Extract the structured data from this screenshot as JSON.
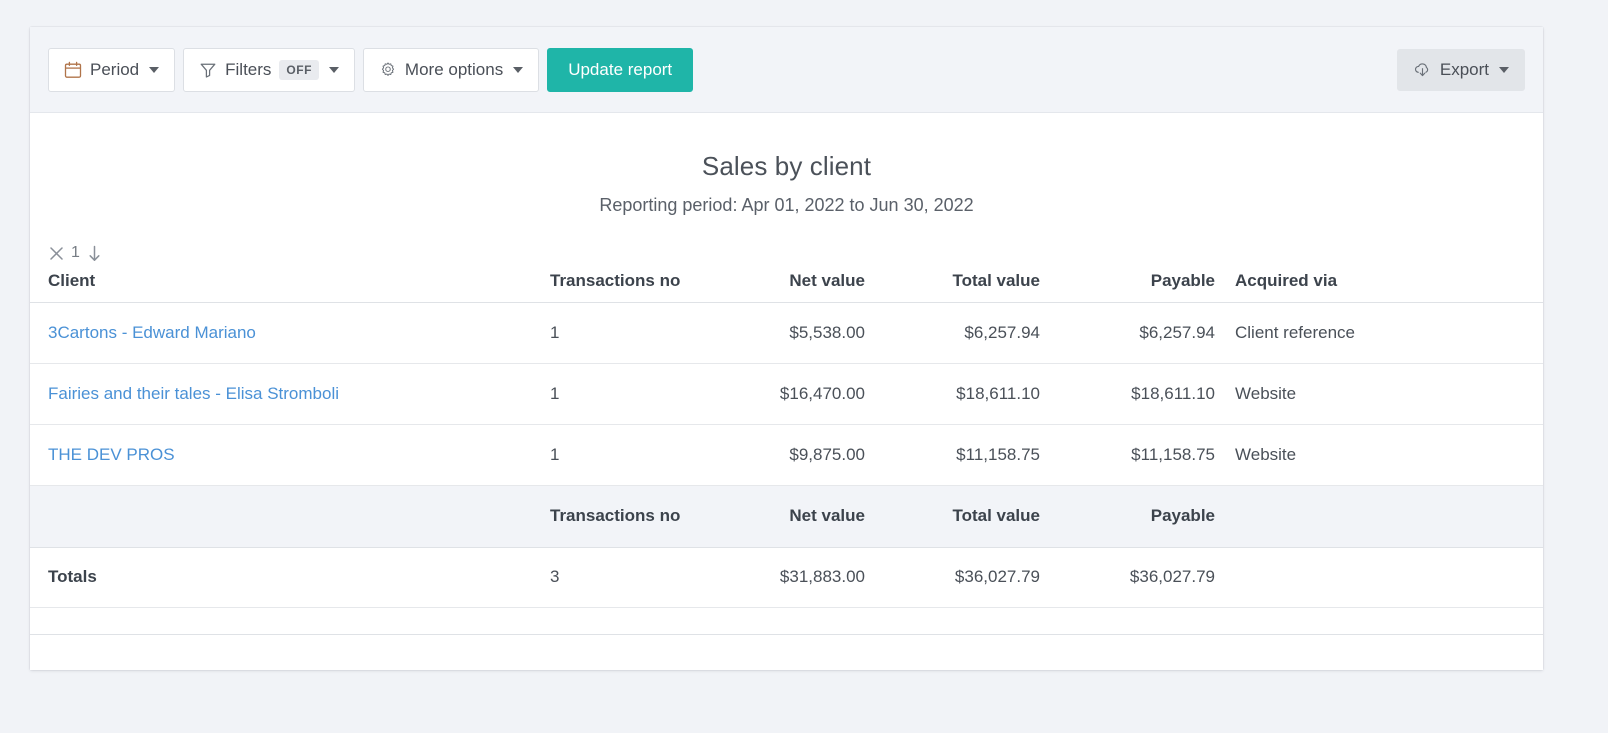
{
  "toolbar": {
    "period_label": "Period",
    "period_icon": "calendar-icon",
    "filters_label": "Filters",
    "filters_icon": "funnel-icon",
    "filters_state": "OFF",
    "more_options_label": "More options",
    "more_options_icon": "gear-icon",
    "update_report_label": "Update report",
    "export_label": "Export",
    "export_icon": "cloud-download-icon",
    "primary_color": "#1fb5a8",
    "toolbar_bg": "#f2f4f8"
  },
  "report": {
    "title": "Sales by client",
    "subtitle": "Reporting period: Apr 01, 2022 to Jun 30, 2022",
    "sort": {
      "clear_icon": "close-x-icon",
      "index": "1",
      "direction_icon": "arrow-down-icon"
    },
    "columns": [
      "Client",
      "Transactions no",
      "Net value",
      "Total value",
      "Payable",
      "Acquired via"
    ],
    "rows": [
      {
        "client": "3Cartons - Edward Mariano",
        "transactions": "1",
        "net_value": "$5,538.00",
        "total_value": "$6,257.94",
        "payable": "$6,257.94",
        "acquired_via": "Client reference"
      },
      {
        "client": "Fairies and their tales - Elisa Stromboli",
        "transactions": "1",
        "net_value": "$16,470.00",
        "total_value": "$18,611.10",
        "payable": "$18,611.10",
        "acquired_via": "Website"
      },
      {
        "client": "THE DEV PROS",
        "transactions": "1",
        "net_value": "$9,875.00",
        "total_value": "$11,158.75",
        "payable": "$11,158.75",
        "acquired_via": "Website"
      }
    ],
    "totals_header": {
      "transactions": "Transactions no",
      "net_value": "Net value",
      "total_value": "Total value",
      "payable": "Payable"
    },
    "totals": {
      "label": "Totals",
      "transactions": "3",
      "net_value": "$31,883.00",
      "total_value": "$36,027.79",
      "payable": "$36,027.79"
    }
  }
}
